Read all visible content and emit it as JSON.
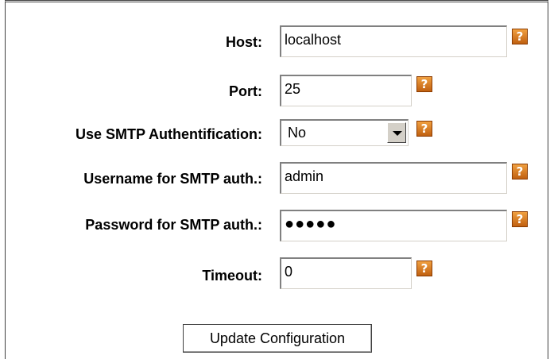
{
  "form": {
    "host": {
      "label": "Host:",
      "value": "localhost"
    },
    "port": {
      "label": "Port:",
      "value": "25"
    },
    "smtp_auth": {
      "label": "Use SMTP Authentification:",
      "value": "No"
    },
    "username": {
      "label": "Username for SMTP auth.:",
      "value": "admin"
    },
    "password": {
      "label": "Password for SMTP auth.:",
      "value": "●●●●●"
    },
    "timeout": {
      "label": "Timeout:",
      "value": "0"
    },
    "help_glyph": "?",
    "submit_label": "Update Configuration"
  },
  "icons": {
    "help": "question-mark-icon",
    "dropdown": "chevron-down-icon"
  },
  "colors": {
    "help_icon": "#d97a1f"
  }
}
